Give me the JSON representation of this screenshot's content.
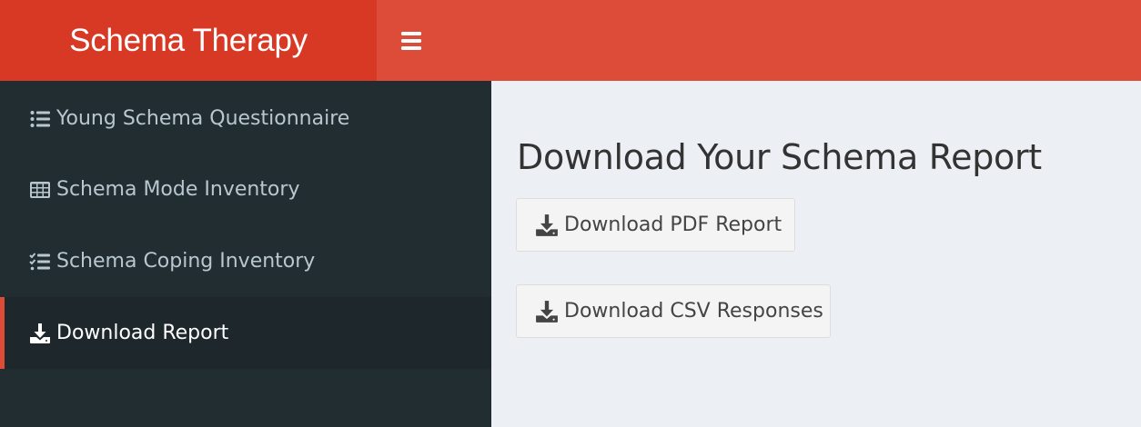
{
  "header": {
    "logo": "Schema Therapy",
    "toggle_icon": "hamburger-icon",
    "colors": {
      "header_bg": "#dd4b39",
      "logo_bg": "#d73925"
    }
  },
  "sidebar": {
    "colors": {
      "bg": "#222d32",
      "active_bg": "#1e282c",
      "text": "#b8c7ce",
      "active_border": "#dd4b39"
    },
    "items": [
      {
        "label": "Young Schema Questionnaire",
        "icon": "list-icon",
        "active": false
      },
      {
        "label": "Schema Mode Inventory",
        "icon": "table-icon",
        "active": false
      },
      {
        "label": "Schema Coping Inventory",
        "icon": "checklist-icon",
        "active": false
      },
      {
        "label": "Download Report",
        "icon": "download-icon",
        "active": true
      }
    ]
  },
  "main": {
    "title": "Download Your Schema Report",
    "buttons": {
      "pdf": {
        "label": "Download PDF Report",
        "icon": "download-icon"
      },
      "csv": {
        "label": "Download CSV Responses",
        "icon": "download-icon"
      }
    }
  }
}
